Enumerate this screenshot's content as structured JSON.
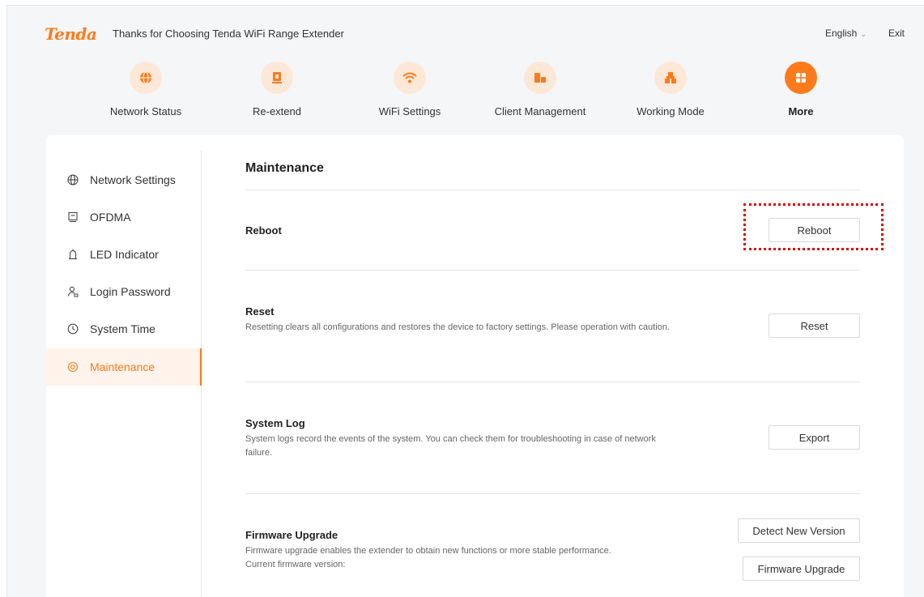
{
  "header": {
    "logo": "Tenda",
    "title": "Thanks for Choosing Tenda WiFi Range Extender",
    "language": "English",
    "exit": "Exit"
  },
  "nav": [
    {
      "label": "Network Status",
      "icon": "globe-icon"
    },
    {
      "label": "Re-extend",
      "icon": "extender-icon"
    },
    {
      "label": "WiFi Settings",
      "icon": "wifi-icon"
    },
    {
      "label": "Client Management",
      "icon": "clients-icon"
    },
    {
      "label": "Working Mode",
      "icon": "mode-icon"
    },
    {
      "label": "More",
      "icon": "more-grid-icon",
      "active": true
    }
  ],
  "sidebar": [
    {
      "label": "Network Settings",
      "icon": "globe-icon"
    },
    {
      "label": "OFDMA",
      "icon": "monitor-icon"
    },
    {
      "label": "LED Indicator",
      "icon": "led-icon"
    },
    {
      "label": "Login Password",
      "icon": "user-lock-icon"
    },
    {
      "label": "System Time",
      "icon": "clock-icon"
    },
    {
      "label": "Maintenance",
      "icon": "gear-icon",
      "active": true
    }
  ],
  "main": {
    "title": "Maintenance",
    "reboot": {
      "title": "Reboot",
      "button": "Reboot"
    },
    "reset": {
      "title": "Reset",
      "desc": "Resetting clears all configurations and restores the device to factory settings. Please operation with caution.",
      "button": "Reset"
    },
    "syslog": {
      "title": "System Log",
      "desc": "System logs record the events of the system. You can check them for troubleshooting in case of network failure.",
      "button": "Export"
    },
    "firmware": {
      "title": "Firmware Upgrade",
      "desc": "Firmware upgrade enables the extender to obtain new functions or more stable performance.",
      "version_label": "Current firmware version:",
      "detect_button": "Detect New Version",
      "upgrade_button": "Firmware Upgrade"
    }
  },
  "colors": {
    "accent": "#ff7a1a",
    "accent_light": "#fde8d8",
    "highlight": "#e00000"
  }
}
